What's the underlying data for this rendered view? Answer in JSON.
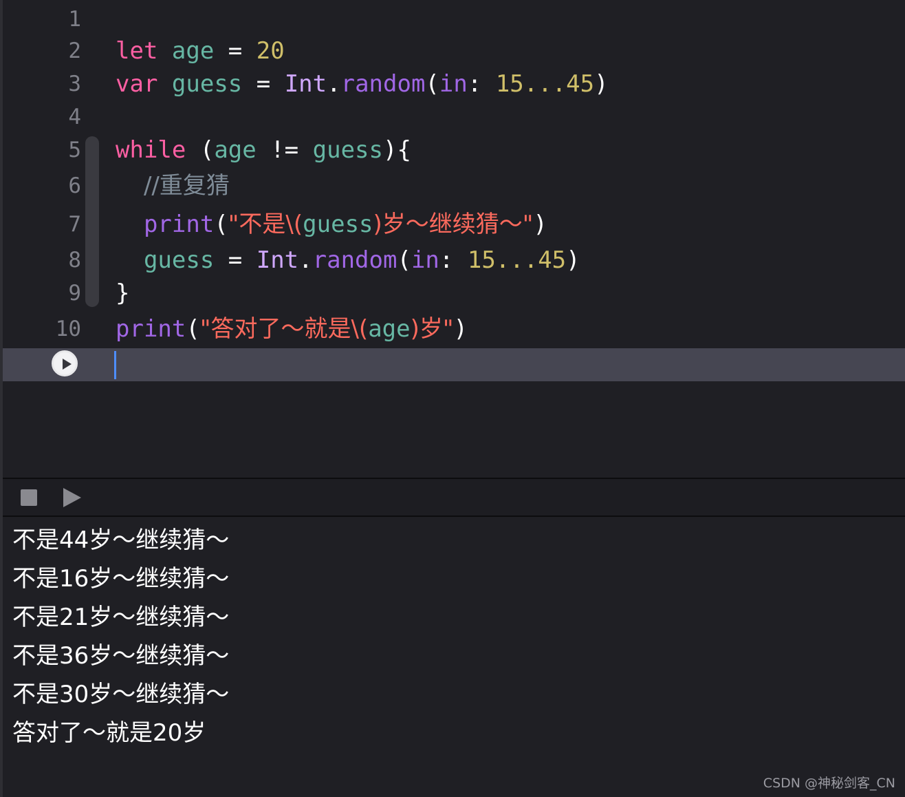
{
  "editor": {
    "line_numbers": [
      "1",
      "2",
      "3",
      "4",
      "5",
      "6",
      "7",
      "8",
      "9",
      "10"
    ],
    "lines": {
      "l2": {
        "kw": "let",
        "name": "age",
        "eq": " = ",
        "num": "20"
      },
      "l3": {
        "kw": "var",
        "name": "guess",
        "eq": " = ",
        "type": "Int",
        "dot": ".",
        "fn": "random",
        "open": "(",
        "label": "in",
        "colon": ": ",
        "range": "15...45",
        "close": ")"
      },
      "l5": {
        "kw": "while",
        "open": " (",
        "a": "age",
        "op": " != ",
        "b": "guess",
        "close": "){"
      },
      "l6": {
        "comment": "//重复猜"
      },
      "l7": {
        "fn": "print",
        "open": "(",
        "str_a": "\"不是\\(",
        "interp": "guess",
        "str_b": ")岁～继续猜～\"",
        "close": ")"
      },
      "l8": {
        "name": "guess",
        "eq": " = ",
        "type": "Int",
        "dot": ".",
        "fn": "random",
        "open": "(",
        "label": "in",
        "colon": ": ",
        "range": "15...45",
        "close": ")"
      },
      "l9": {
        "brace": "}"
      },
      "l10": {
        "fn": "print",
        "open": "(",
        "str_a": "\"答对了～就是\\(",
        "interp": "age",
        "str_b": ")岁\"",
        "close": ")"
      }
    }
  },
  "debug_bar": {
    "stop_icon": "stop-icon",
    "run_icon": "play-icon"
  },
  "console": {
    "output": [
      "不是44岁～继续猜～",
      "不是16岁～继续猜～",
      "不是21岁～继续猜～",
      "不是36岁～继续猜～",
      "不是30岁～继续猜～",
      "答对了～就是20岁"
    ]
  },
  "watermark": "CSDN @神秘剑客_CN",
  "colors": {
    "background": "#1f1f24",
    "keyword": "#fc5fa3",
    "variable": "#67b7a4",
    "type": "#d0a8ff",
    "function": "#a167e6",
    "number": "#d0bf69",
    "string": "#fc6a5d",
    "comment": "#7f8c98",
    "current_line": "#464652",
    "cursor": "#4e8eff"
  }
}
